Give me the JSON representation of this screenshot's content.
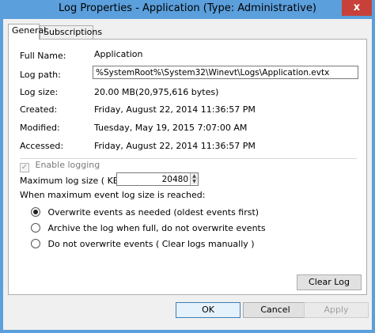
{
  "window": {
    "title": "Log Properties - Application (Type: Administrative)",
    "close_glyph": "x"
  },
  "tabs": [
    {
      "label": "General",
      "active": true
    },
    {
      "label": "Subscriptions",
      "active": false
    }
  ],
  "general": {
    "full_name_label": "Full Name:",
    "full_name_value": "Application",
    "log_path_label": "Log path:",
    "log_path_value": "%SystemRoot%\\System32\\Winevt\\Logs\\Application.evtx",
    "log_size_label": "Log size:",
    "log_size_value": "20.00 MB(20,975,616 bytes)",
    "created_label": "Created:",
    "created_value": "Friday, August 22, 2014 11:36:57 PM",
    "modified_label": "Modified:",
    "modified_value": "Tuesday, May 19, 2015 7:07:00 AM",
    "accessed_label": "Accessed:",
    "accessed_value": "Friday, August 22, 2014 11:36:57 PM",
    "enable_logging_label": "Enable logging",
    "enable_logging_checked": true,
    "max_size_label": "Maximum log size ( KB ):",
    "max_size_value": "20480",
    "when_max_label": "When maximum event log size is reached:",
    "policies": [
      {
        "label": "Overwrite events as needed (oldest events first)",
        "checked": true
      },
      {
        "label": "Archive the log when full, do not overwrite events",
        "checked": false
      },
      {
        "label": "Do not overwrite events ( Clear logs manually )",
        "checked": false
      }
    ],
    "clear_log_label": "Clear Log"
  },
  "footer": {
    "ok_label": "OK",
    "cancel_label": "Cancel",
    "apply_label": "Apply"
  },
  "colors": {
    "titlebar": "#5b9fdc",
    "close": "#c7413a"
  }
}
